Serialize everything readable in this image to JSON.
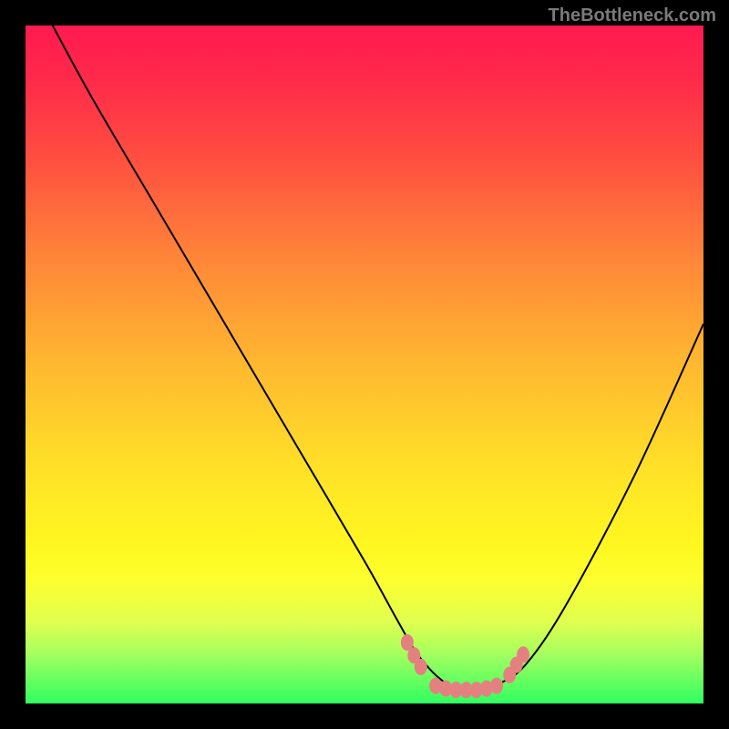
{
  "watermark": "TheBottleneck.com",
  "chart_data": {
    "type": "line",
    "title": "",
    "xlabel": "",
    "ylabel": "",
    "xlim": [
      0,
      100
    ],
    "ylim": [
      0,
      100
    ],
    "series": [
      {
        "name": "curve",
        "x": [
          4,
          10,
          20,
          30,
          40,
          50,
          55,
          58,
          62,
          66,
          70,
          74,
          80,
          90,
          100
        ],
        "values": [
          100,
          89,
          72,
          55,
          38,
          21,
          12,
          7,
          3,
          2,
          3,
          6,
          15,
          34,
          56
        ]
      }
    ],
    "markers": {
      "color": "#e58080",
      "points": [
        {
          "x": 56.3,
          "y": 9.0
        },
        {
          "x": 57.3,
          "y": 7.1
        },
        {
          "x": 58.3,
          "y": 5.4
        },
        {
          "x": 60.5,
          "y": 2.6
        },
        {
          "x": 62.0,
          "y": 2.2
        },
        {
          "x": 63.5,
          "y": 2.0
        },
        {
          "x": 65.0,
          "y": 2.0
        },
        {
          "x": 66.5,
          "y": 2.0
        },
        {
          "x": 68.0,
          "y": 2.2
        },
        {
          "x": 69.5,
          "y": 2.6
        },
        {
          "x": 71.4,
          "y": 4.2
        },
        {
          "x": 72.4,
          "y": 5.7
        },
        {
          "x": 73.4,
          "y": 7.2
        }
      ]
    }
  }
}
